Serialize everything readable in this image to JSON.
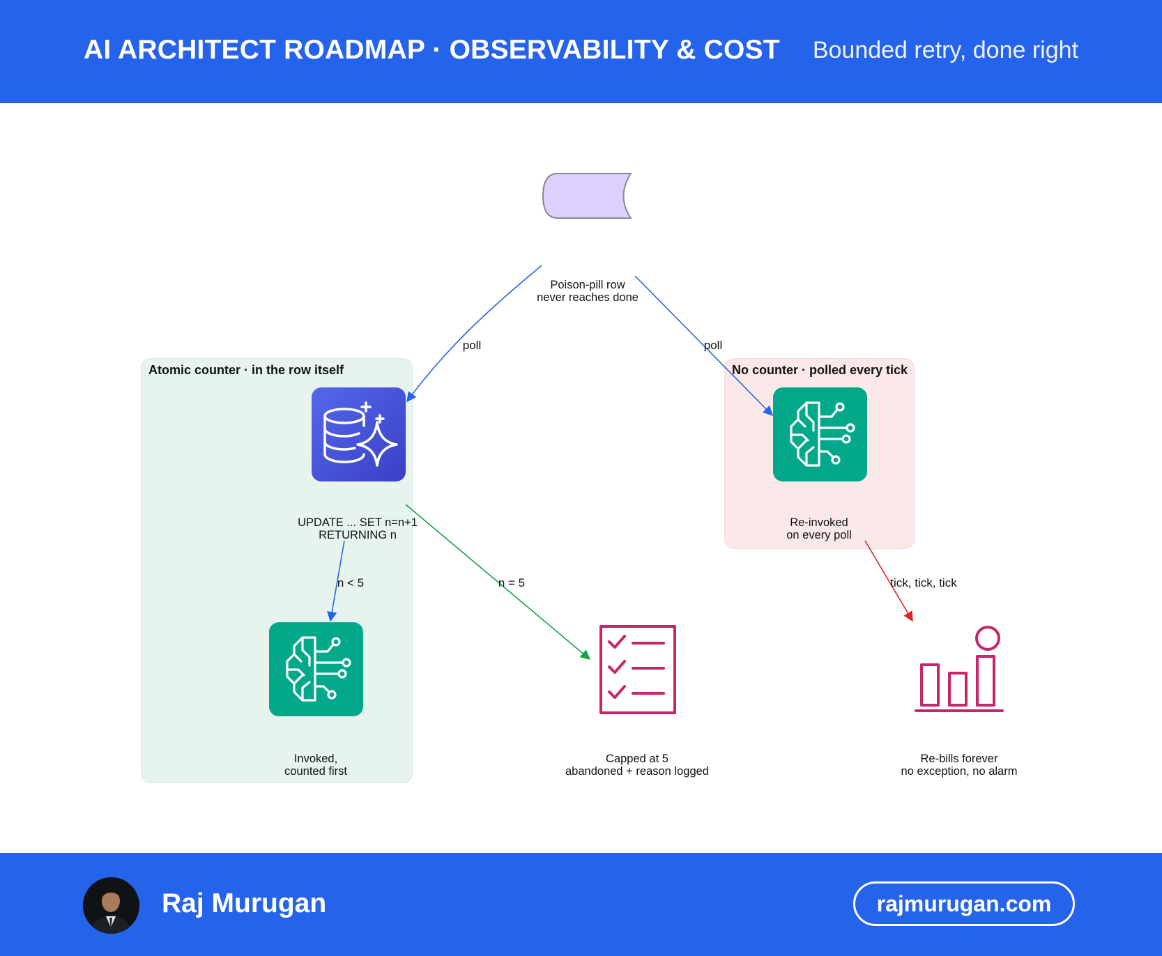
{
  "header": {
    "title": "AI ARCHITECT ROADMAP · OBSERVABILITY & COST",
    "subtitle": "Bounded retry, done right"
  },
  "footer": {
    "author": "Raj Murugan",
    "website": "rajmurugan.com"
  },
  "colors": {
    "brand": "#2563eb",
    "green_group": "#e7f4ee",
    "red_group": "#fbe9e9",
    "start_node": "#ddd0ff",
    "db_icon": "#4450d6",
    "ml_icon": "#03a88a",
    "pink_icon": "#c7266a",
    "edge_blue": "#2563eb",
    "edge_green": "#16a34a",
    "edge_red": "#dc2626"
  },
  "diagram": {
    "start": {
      "icon": "poison-pill-queue-shape",
      "caption": [
        "Poison-pill row",
        "never reaches done"
      ]
    },
    "groups": {
      "left": {
        "label": "Atomic counter · in the row itself"
      },
      "right": {
        "label": "No counter · polled every tick"
      }
    },
    "nodes": {
      "counter": {
        "icon": "database-sparkle-icon",
        "caption": [
          "UPDATE ... SET n=n+1",
          "RETURNING n"
        ]
      },
      "invoke_left": {
        "icon": "ai-brain-icon",
        "caption": [
          "Invoked,",
          "counted first"
        ]
      },
      "capped": {
        "icon": "checklist-icon",
        "caption": [
          "Capped at 5",
          "abandoned + reason logged"
        ]
      },
      "invoke_right": {
        "icon": "ai-brain-icon",
        "caption": [
          "Re-invoked",
          "on every poll"
        ]
      },
      "rebills": {
        "icon": "bar-chart-alarm-icon",
        "caption": [
          "Re-bills forever",
          "no exception, no alarm"
        ]
      }
    },
    "edges": [
      {
        "from": "start",
        "to": "counter",
        "label": "poll",
        "color": "#2563eb"
      },
      {
        "from": "start",
        "to": "invoke_right",
        "label": "poll",
        "color": "#2563eb"
      },
      {
        "from": "counter",
        "to": "invoke_left",
        "label": "n < 5",
        "color": "#2563eb"
      },
      {
        "from": "counter",
        "to": "capped",
        "label": "n = 5",
        "color": "#16a34a"
      },
      {
        "from": "invoke_right",
        "to": "rebills",
        "label": "tick, tick, tick",
        "color": "#dc2626"
      }
    ]
  }
}
